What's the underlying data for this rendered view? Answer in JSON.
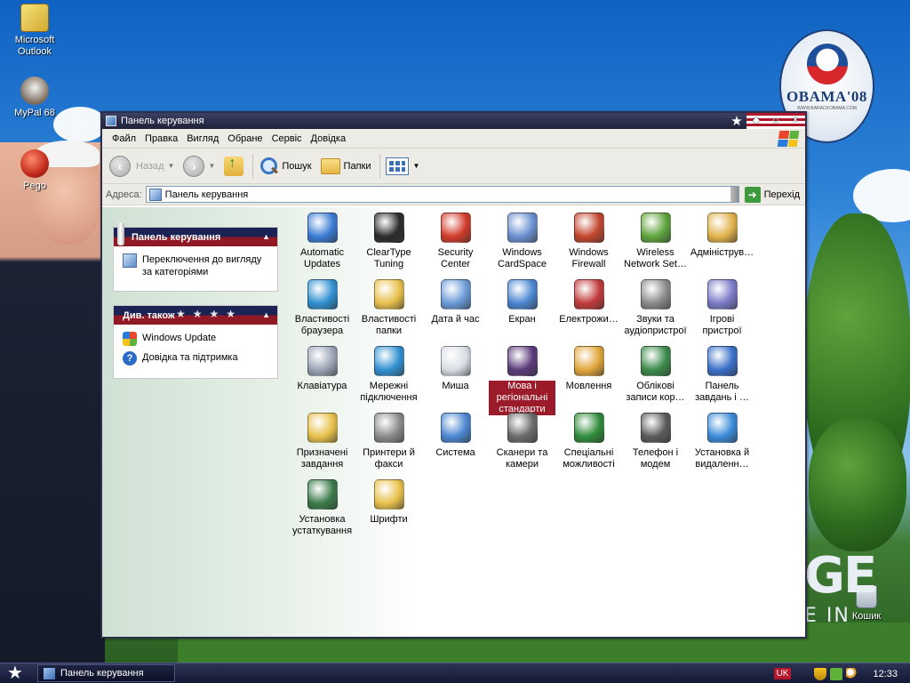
{
  "desktop": {
    "icons": [
      {
        "label": "Microsoft Outlook",
        "name": "desktop-icon-outlook"
      },
      {
        "label": "MyPal 68",
        "name": "desktop-icon-mypal"
      },
      {
        "label": "Pego",
        "name": "desktop-icon-pego"
      },
      {
        "label": "Кошик",
        "name": "desktop-icon-recycle-bin"
      }
    ],
    "badge": {
      "text": "OBAMA'08",
      "subtext": "WWW.BARACKOBAMA.COM"
    },
    "wallpaper_text": {
      "big": "GE",
      "small": "E IN"
    }
  },
  "window": {
    "title": "Панель керування",
    "menu": [
      "Файл",
      "Правка",
      "Вигляд",
      "Обране",
      "Сервіс",
      "Довідка"
    ],
    "toolbar": {
      "back": "Назад",
      "search": "Пошук",
      "folders": "Папки"
    },
    "address": {
      "label": "Адреса:",
      "value": "Панель керування",
      "go": "Перехід"
    },
    "panels": {
      "control_panel": {
        "title": "Панель керування",
        "link": "Переключення до вигляду за категоріями"
      },
      "see_also": {
        "title": "Див. також",
        "links": [
          "Windows Update",
          "Довідка та підтримка"
        ]
      }
    },
    "items": [
      {
        "label": "Automatic Updates",
        "icon": "automatic-updates-icon",
        "color": "#3a7bd5"
      },
      {
        "label": "ClearType Tuning",
        "icon": "cleartype-icon",
        "color": "#2b2b2b"
      },
      {
        "label": "Security Center",
        "icon": "security-center-icon",
        "color": "#d13a2a"
      },
      {
        "label": "Windows CardSpace",
        "icon": "cardspace-icon",
        "color": "#6a8fd0"
      },
      {
        "label": "Windows Firewall",
        "icon": "firewall-icon",
        "color": "#c2452d"
      },
      {
        "label": "Wireless Network Set…",
        "icon": "wireless-network-icon",
        "color": "#5ea33b"
      },
      {
        "label": "Адмініструв…",
        "icon": "administrative-tools-icon",
        "color": "#e0b24a"
      },
      {
        "label": "Властивості браузера",
        "icon": "internet-options-icon",
        "color": "#2f8fd0"
      },
      {
        "label": "Властивості папки",
        "icon": "folder-options-icon",
        "color": "#e8c04a"
      },
      {
        "label": "Дата й час",
        "icon": "date-time-icon",
        "color": "#6a9ad8"
      },
      {
        "label": "Екран",
        "icon": "display-icon",
        "color": "#4a86d0"
      },
      {
        "label": "Електрожи…",
        "icon": "power-options-icon",
        "color": "#c23a3a"
      },
      {
        "label": "Звуки та аудіопристрої",
        "icon": "sounds-icon",
        "color": "#8a8a8a"
      },
      {
        "label": "Ігрові пристрої",
        "icon": "game-controllers-icon",
        "color": "#7a7ac8"
      },
      {
        "label": "Клавіатура",
        "icon": "keyboard-icon",
        "color": "#9aa4b4"
      },
      {
        "label": "Мережні підключення",
        "icon": "network-connections-icon",
        "color": "#2f8fd0"
      },
      {
        "label": "Миша",
        "icon": "mouse-icon",
        "color": "#d8dde4"
      },
      {
        "label": "Мова і регіональні стандарти",
        "icon": "regional-options-icon",
        "color": "#5a3a7a",
        "selected": true
      },
      {
        "label": "Мовлення",
        "icon": "speech-icon",
        "color": "#e0a53a"
      },
      {
        "label": "Облікові записи кор…",
        "icon": "user-accounts-icon",
        "color": "#3a8a4a"
      },
      {
        "label": "Панель завдань і …",
        "icon": "taskbar-start-menu-icon",
        "color": "#3a6fc8"
      },
      {
        "label": "Призначені завдання",
        "icon": "scheduled-tasks-icon",
        "color": "#e8c04a"
      },
      {
        "label": "Принтери й факси",
        "icon": "printers-faxes-icon",
        "color": "#8a8a8a"
      },
      {
        "label": "Система",
        "icon": "system-icon",
        "color": "#4a86d0"
      },
      {
        "label": "Сканери та камери",
        "icon": "scanners-cameras-icon",
        "color": "#6a6a6a"
      },
      {
        "label": "Спеціальні можливості",
        "icon": "accessibility-icon",
        "color": "#2e8b3a"
      },
      {
        "label": "Телефон і модем",
        "icon": "phone-modem-icon",
        "color": "#5a5a5a"
      },
      {
        "label": "Установка й видаленн…",
        "icon": "add-remove-programs-icon",
        "color": "#3a8ad8"
      },
      {
        "label": "Установка устаткування",
        "icon": "add-hardware-icon",
        "color": "#3a7a4a"
      },
      {
        "label": "Шрифти",
        "icon": "fonts-icon",
        "color": "#e8c04a"
      }
    ]
  },
  "taskbar": {
    "task_label": "Панель керування",
    "language": "UK",
    "clock": "12:33"
  }
}
